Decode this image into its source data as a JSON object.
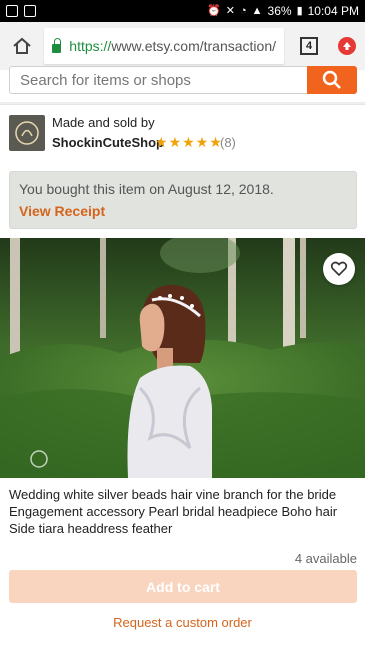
{
  "status_bar": {
    "battery": "36%",
    "time": "10:04 PM"
  },
  "browser": {
    "url_secure": "https://",
    "url_rest": "www.etsy.com/transaction/",
    "tab_count": "4"
  },
  "search": {
    "placeholder": "Search for items or shops"
  },
  "shop": {
    "made_label": "Made and sold by",
    "name": "ShockinCuteShop",
    "rating_stars": 5,
    "review_count": "(8)"
  },
  "receipt": {
    "message": "You bought this item on August 12, 2018.",
    "link": "View Receipt"
  },
  "product": {
    "title": "Wedding white silver beads hair vine branch for the bride Engagement accessory Pearl bridal headpiece Boho hair Side tiara headdress feather",
    "availability": "4 available",
    "add_to_cart": "Add to cart",
    "custom_order": "Request a custom order"
  },
  "colors": {
    "accent": "#f1641e",
    "link": "#d5641c",
    "secure": "#1e8e3e",
    "star": "#f1a208"
  }
}
